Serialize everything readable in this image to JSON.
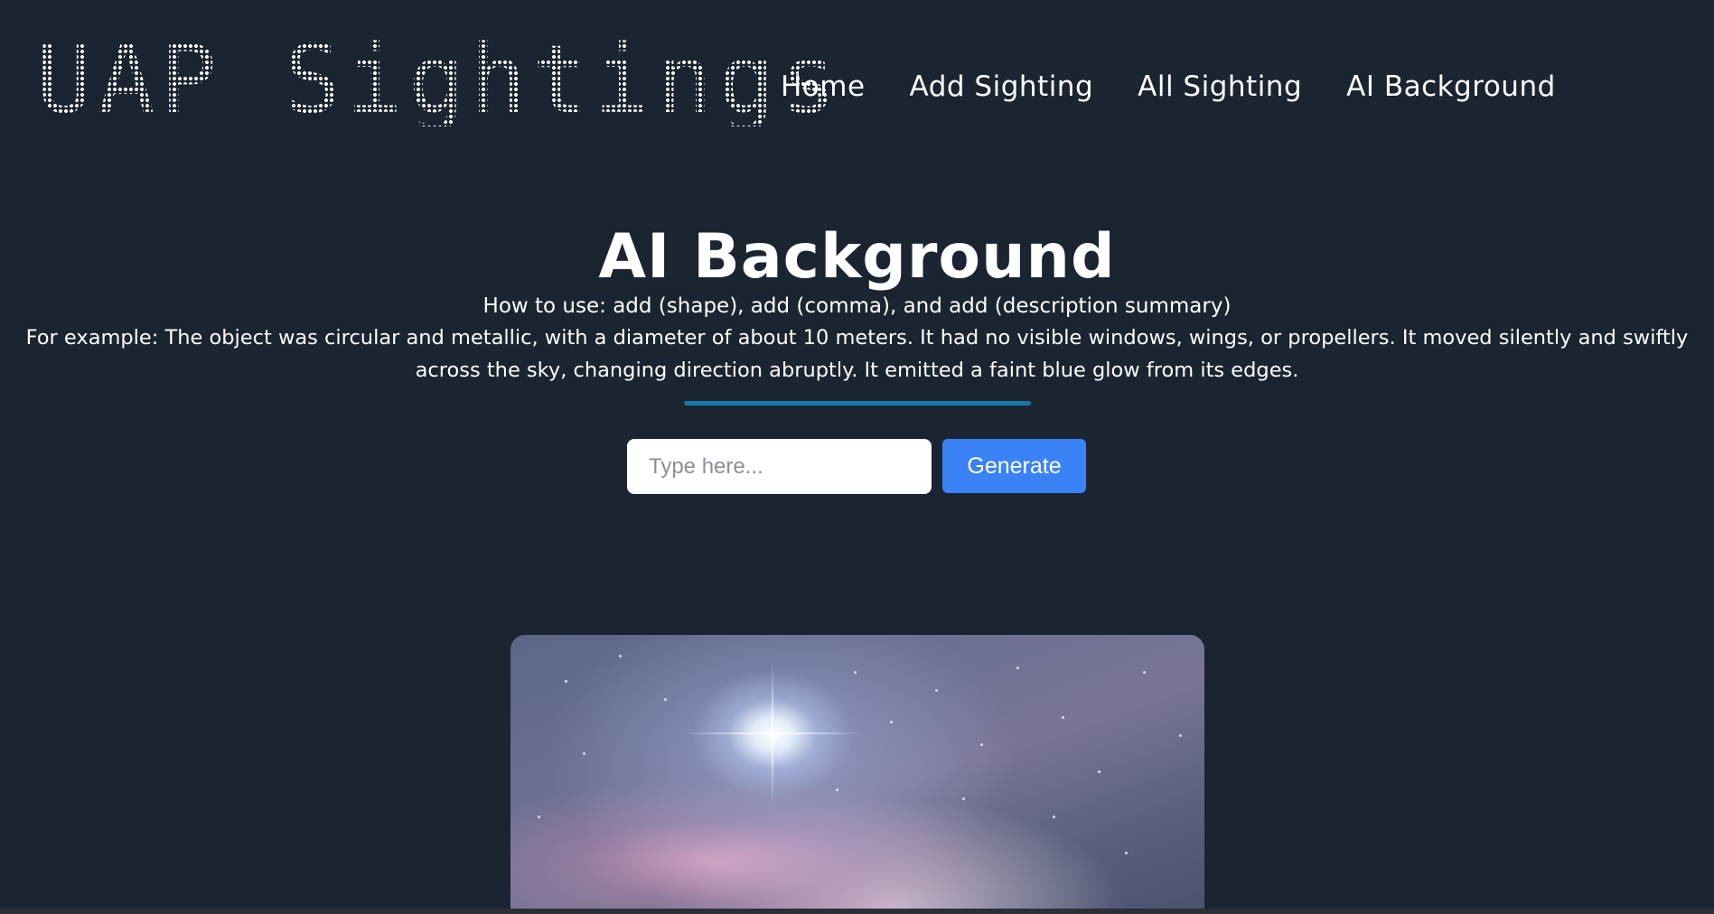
{
  "header": {
    "logo_text": "UAP Sightings",
    "nav": [
      {
        "label": "Home"
      },
      {
        "label": "Add Sighting"
      },
      {
        "label": "All Sighting"
      },
      {
        "label": "AI Background"
      }
    ]
  },
  "main": {
    "title": "AI Background",
    "howto": "How to use: add (shape), add (comma), and add (description summary)",
    "example_line1": "For example: The object was circular and metallic, with a diameter of about 10 meters. It had no visible windows, wings, or propellers. It moved silently and swiftly",
    "example_line2": "across the sky, changing direction abruptly. It emitted a faint blue glow from its edges.",
    "accent_color": "#1779a9"
  },
  "form": {
    "input_value": "",
    "input_placeholder": "Type here...",
    "generate_label": "Generate",
    "button_color": "#3b82f6"
  }
}
